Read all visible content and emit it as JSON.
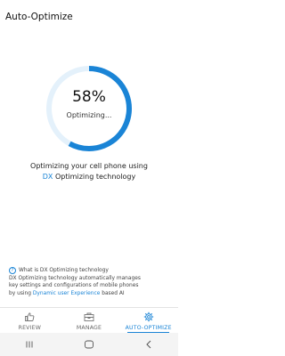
{
  "header": {
    "title": "Auto-Optimize"
  },
  "gauge": {
    "percent_label": "58%",
    "progress": 0.58,
    "status": "Optimizing...",
    "accent": "#1a84d6",
    "track": "#e4f1fb"
  },
  "message": {
    "line1": "Optimizing your cell phone using",
    "line2_accent": "DX",
    "line2_rest": " Optimizing technology"
  },
  "info": {
    "title": "What is DX Optimizing technology",
    "line1": "DX Optimizing technology automatically manages",
    "line2": "key settings and configurations of mobile phones",
    "line3_pre": "by using ",
    "line3_accent": "Dynamic user Experience",
    "line3_post": " based AI"
  },
  "tabs": [
    {
      "label": "REVIEW",
      "icon": "thumbs-up-icon"
    },
    {
      "label": "MANAGE",
      "icon": "toolbox-icon"
    },
    {
      "label": "AUTO-OPTIMIZE",
      "icon": "gear-icon",
      "active": true
    }
  ],
  "navbar": {
    "recents": "recents-icon",
    "home": "home-icon",
    "back": "back-icon"
  }
}
